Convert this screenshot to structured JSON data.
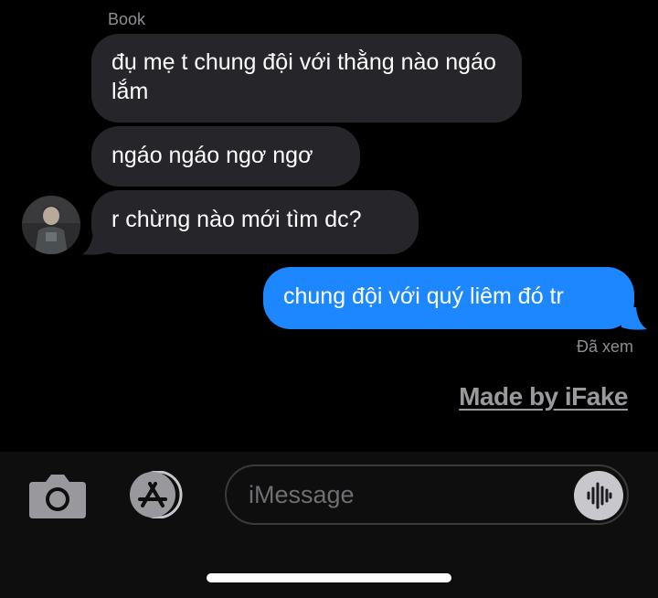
{
  "conversation": {
    "sender_name": "Book",
    "messages": [
      {
        "direction": "incoming",
        "text": "đụ mẹ t chung đội với thằng nào ngáo lắm"
      },
      {
        "direction": "incoming",
        "text": "ngáo ngáo ngơ ngơ"
      },
      {
        "direction": "incoming",
        "text": "r chừng nào mới tìm dc?"
      },
      {
        "direction": "outgoing",
        "text": "chung đội với quý liêm đó tr"
      }
    ],
    "read_receipt": "Đã xem",
    "watermark": "Made by iFake"
  },
  "composer": {
    "placeholder": "iMessage",
    "icons": [
      "camera-icon",
      "app-store-icon",
      "audio-waveform-icon"
    ]
  },
  "colors": {
    "incoming_bubble": "#26252a",
    "outgoing_bubble": "#1c87ff",
    "background": "#000000"
  }
}
